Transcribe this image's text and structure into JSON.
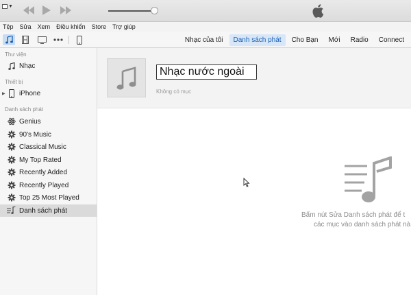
{
  "player": {
    "controls": [
      "rewind-icon",
      "play-icon",
      "fast-forward-icon"
    ],
    "volume_level": 0.9,
    "logo": "apple-logo-icon"
  },
  "menubar": [
    "Tệp",
    "Sửa",
    "Xem",
    "Điều khiển",
    "Store",
    "Trợ giúp"
  ],
  "navbar": {
    "media_icons": [
      "music-note-icon",
      "film-icon",
      "tv-icon",
      "more-icon",
      "iphone-icon"
    ],
    "tabs": [
      "Nhạc của tôi",
      "Danh sách phát",
      "Cho Bạn",
      "Mới",
      "Radio",
      "Connect"
    ],
    "active_tab": "Danh sách phát"
  },
  "sidebar": {
    "library_title": "Thư viện",
    "library_items": [
      {
        "label": "Nhạc",
        "icon": "music-note-icon"
      }
    ],
    "devices_title": "Thiết bị",
    "devices": [
      {
        "label": "iPhone",
        "icon": "iphone-icon"
      }
    ],
    "playlists_title": "Danh sách phát",
    "playlists": [
      {
        "label": "Genius",
        "icon": "genius-atom-icon"
      },
      {
        "label": "90's Music",
        "icon": "gear-icon"
      },
      {
        "label": "Classical Music",
        "icon": "gear-icon"
      },
      {
        "label": "My Top Rated",
        "icon": "gear-icon"
      },
      {
        "label": "Recently Added",
        "icon": "gear-icon"
      },
      {
        "label": "Recently Played",
        "icon": "gear-icon"
      },
      {
        "label": "Top 25 Most Played",
        "icon": "gear-icon"
      },
      {
        "label": "Danh sách phát",
        "icon": "playlist-icon",
        "selected": true
      }
    ]
  },
  "playlist_header": {
    "name": "Nhạc nước ngoài",
    "subtitle": "Không có mục"
  },
  "empty_state": {
    "line1": "Bấm nút Sửa Danh sách phát để t",
    "line2": "các mục vào danh sách phát nà"
  }
}
